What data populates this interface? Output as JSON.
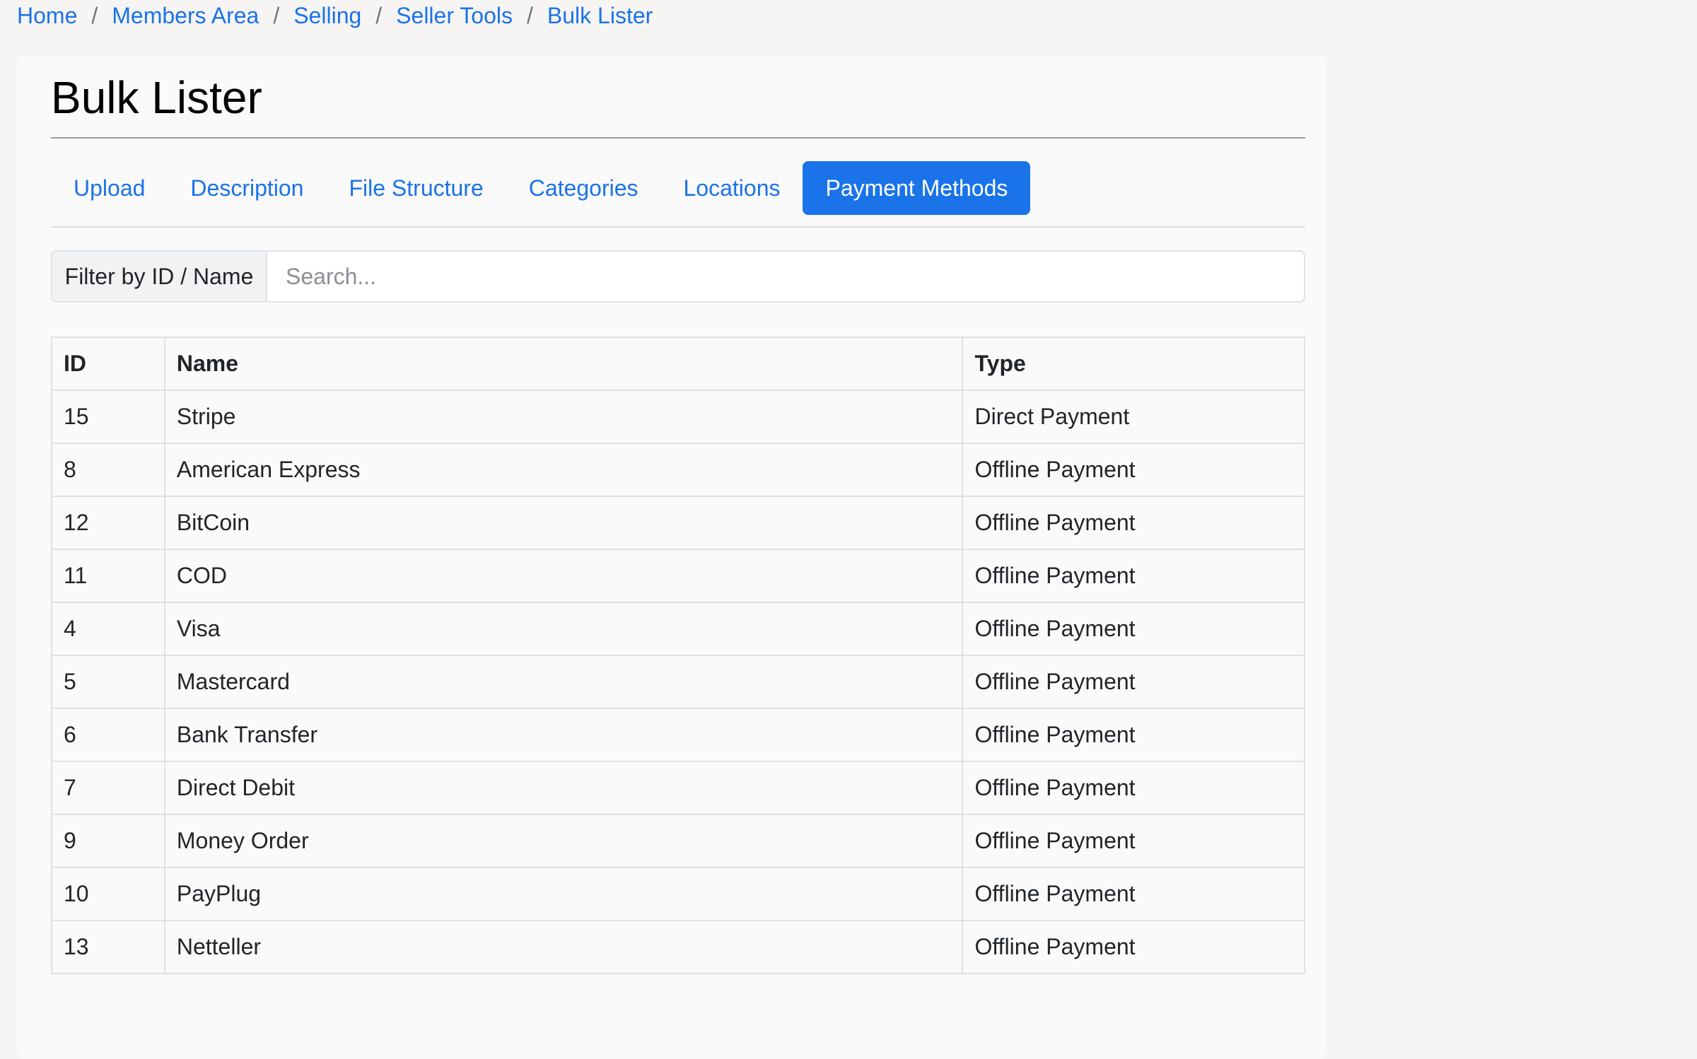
{
  "breadcrumb": [
    {
      "label": "Home"
    },
    {
      "label": "Members Area"
    },
    {
      "label": "Selling"
    },
    {
      "label": "Seller Tools"
    },
    {
      "label": "Bulk Lister"
    }
  ],
  "breadcrumb_separator": "/",
  "page": {
    "title": "Bulk Lister"
  },
  "tabs": [
    {
      "label": "Upload",
      "active": false
    },
    {
      "label": "Description",
      "active": false
    },
    {
      "label": "File Structure",
      "active": false
    },
    {
      "label": "Categories",
      "active": false
    },
    {
      "label": "Locations",
      "active": false
    },
    {
      "label": "Payment Methods",
      "active": true
    }
  ],
  "filter": {
    "label": "Filter by ID / Name",
    "placeholder": "Search...",
    "value": ""
  },
  "table": {
    "headers": {
      "id": "ID",
      "name": "Name",
      "type": "Type"
    },
    "rows": [
      {
        "id": "15",
        "name": "Stripe",
        "type": "Direct Payment"
      },
      {
        "id": "8",
        "name": "American Express",
        "type": "Offline Payment"
      },
      {
        "id": "12",
        "name": "BitCoin",
        "type": "Offline Payment"
      },
      {
        "id": "11",
        "name": "COD",
        "type": "Offline Payment"
      },
      {
        "id": "4",
        "name": "Visa",
        "type": "Offline Payment"
      },
      {
        "id": "5",
        "name": "Mastercard",
        "type": "Offline Payment"
      },
      {
        "id": "6",
        "name": "Bank Transfer",
        "type": "Offline Payment"
      },
      {
        "id": "7",
        "name": "Direct Debit",
        "type": "Offline Payment"
      },
      {
        "id": "9",
        "name": "Money Order",
        "type": "Offline Payment"
      },
      {
        "id": "10",
        "name": "PayPlug",
        "type": "Offline Payment"
      },
      {
        "id": "13",
        "name": "Netteller",
        "type": "Offline Payment"
      }
    ]
  },
  "colors": {
    "accent": "#1a73e8",
    "page_background": "#f6f5f3",
    "card_background": "#fafafa"
  }
}
